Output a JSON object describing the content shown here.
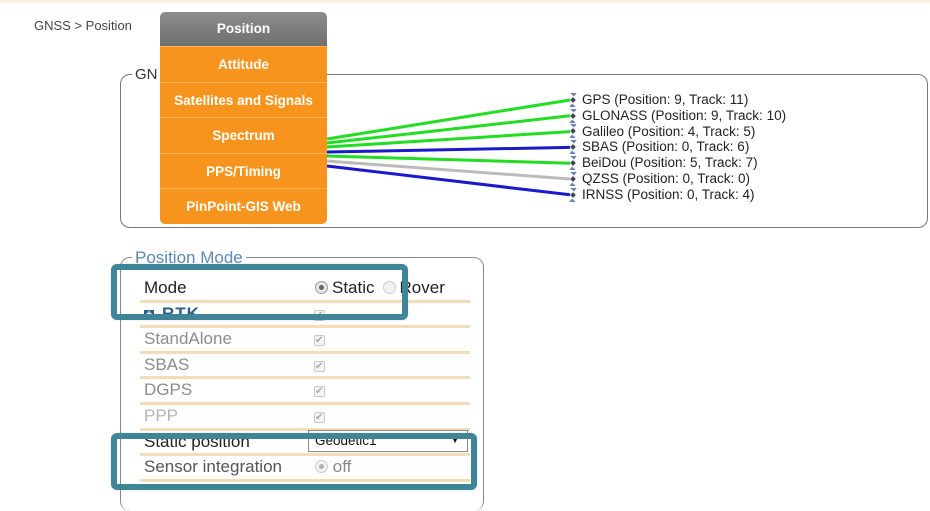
{
  "breadcrumb": "GNSS > Position",
  "menu": {
    "items": [
      {
        "label": "Position",
        "selected": true
      },
      {
        "label": "Attitude"
      },
      {
        "label": "Satellites and Signals"
      },
      {
        "label": "Spectrum"
      },
      {
        "label": "PPS/Timing"
      },
      {
        "label": "PinPoint-GIS Web"
      }
    ]
  },
  "gnss": {
    "legend": "GN",
    "satellites": [
      {
        "label": "GPS (Position: 9, Track: 11)",
        "line_color": "#22dd22",
        "icon": "satellite-icon"
      },
      {
        "label": "GLONASS (Position: 9, Track: 10)",
        "line_color": "#22dd22",
        "icon": "satellite-icon"
      },
      {
        "label": "Galileo (Position: 4, Track: 5)",
        "line_color": "#22dd22",
        "icon": "satellite-icon"
      },
      {
        "label": "SBAS (Position: 0, Track: 6)",
        "line_color": "#1a1acc",
        "icon": "satellite-icon"
      },
      {
        "label": "BeiDou (Position: 5, Track: 7)",
        "line_color": "#22dd22",
        "icon": "satellite-icon"
      },
      {
        "label": "QZSS (Position: 0, Track: 0)",
        "line_color": "#bbbbbb",
        "icon": "satellite-icon"
      },
      {
        "label": "IRNSS (Position: 0, Track: 4)",
        "line_color": "#1a1acc",
        "icon": "satellite-icon"
      }
    ]
  },
  "position_mode": {
    "legend": "Position Mode",
    "mode": {
      "label": "Mode",
      "options": [
        "Static",
        "Rover"
      ],
      "selected": "Static"
    },
    "rtk": {
      "label": "RTK"
    },
    "standalone": {
      "label": "StandAlone",
      "checked": true
    },
    "sbas": {
      "label": "SBAS",
      "checked": true
    },
    "dgps": {
      "label": "DGPS",
      "checked": true
    },
    "ppp": {
      "label": "PPP",
      "checked": true
    },
    "static_position": {
      "label": "Static position",
      "value": "Geodetic1"
    },
    "sensor_integration": {
      "label": "Sensor integration",
      "value": "off"
    }
  },
  "colors": {
    "menu_orange": "#f7941d",
    "menu_selected": "#7a7a7a",
    "highlight": "#3e8597",
    "legend_blue": "#5e86b8"
  }
}
